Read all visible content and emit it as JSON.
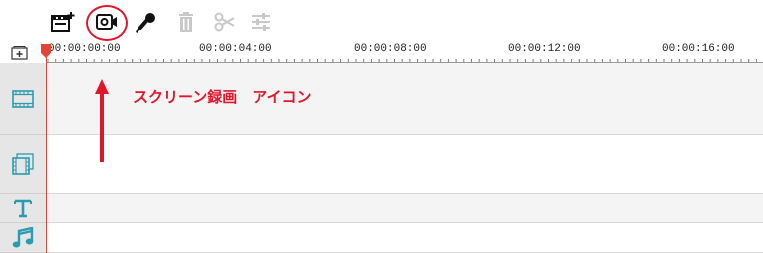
{
  "toolbar": {
    "items": [
      {
        "icon": "add-media-icon",
        "label": ""
      },
      {
        "icon": "record-screen-icon",
        "label": ""
      },
      {
        "icon": "microphone-icon",
        "label": ""
      },
      {
        "icon": "trash-icon",
        "label": ""
      },
      {
        "icon": "split-icon",
        "label": ""
      },
      {
        "icon": "adjust-icon",
        "label": ""
      }
    ]
  },
  "ruler": {
    "labels": [
      "00:00:00:00",
      "00:00:04:00",
      "00:00:08:00",
      "00:00:12:00",
      "00:00:16:00"
    ]
  },
  "tracks": [
    {
      "icon": "video-track-icon"
    },
    {
      "icon": "overlay-track-icon"
    },
    {
      "icon": "text-track-icon"
    },
    {
      "icon": "music-track-icon"
    }
  ],
  "annotation": {
    "text": "スクリーン録画　アイコン"
  },
  "colors": {
    "accent_red": "#e0162b",
    "track_icon": "#2a9bb0",
    "playhead": "#e2463a"
  }
}
